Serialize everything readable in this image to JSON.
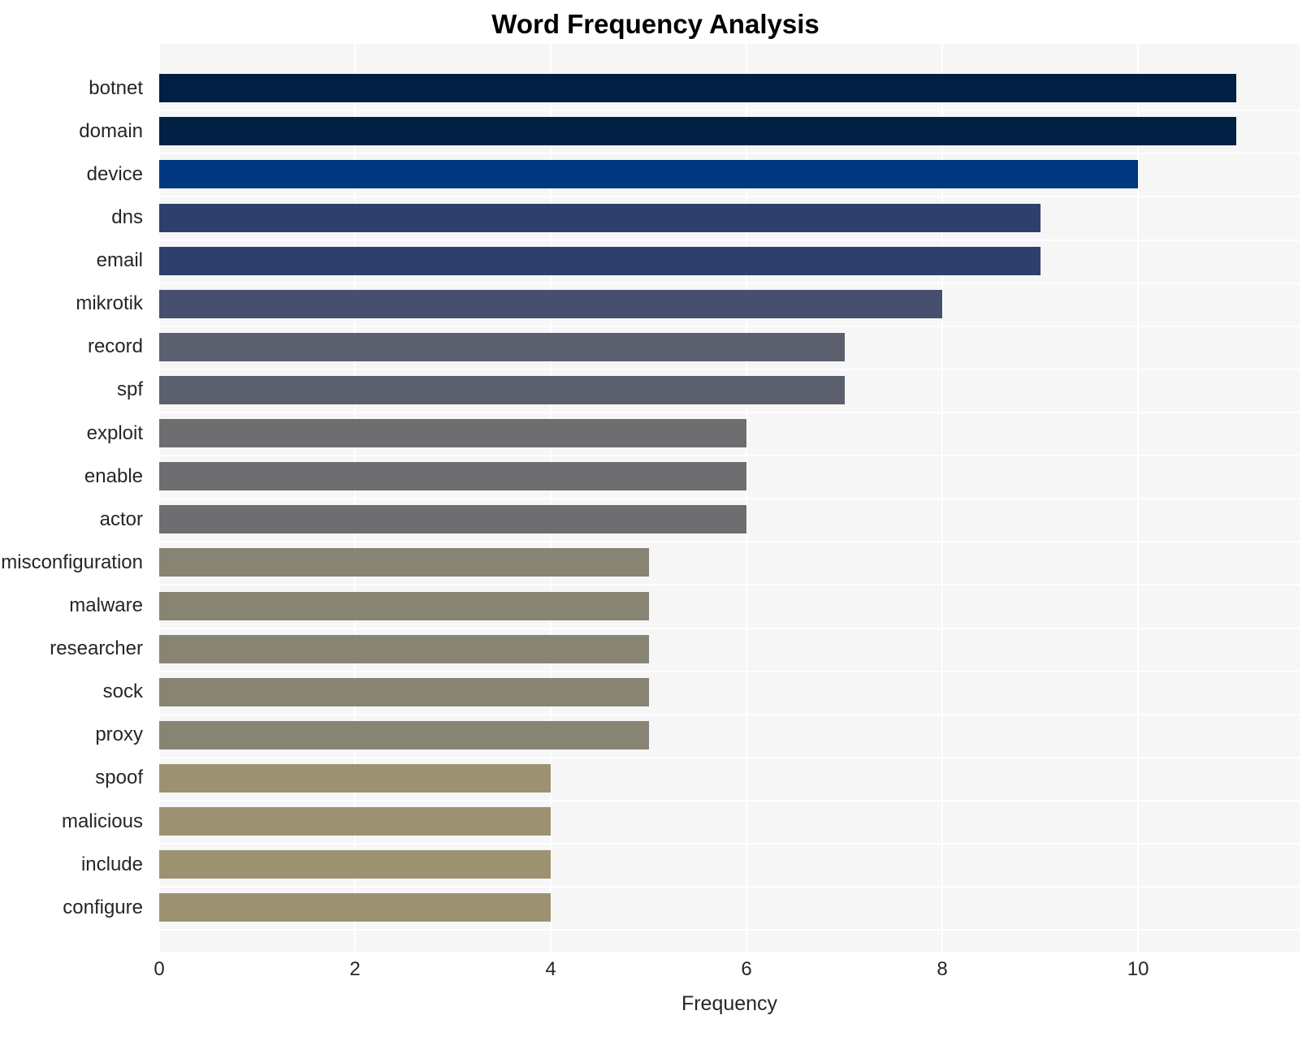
{
  "chart_data": {
    "type": "bar",
    "orientation": "horizontal",
    "title": "Word Frequency Analysis",
    "xlabel": "Frequency",
    "ylabel": "",
    "xlim": [
      0,
      11.65
    ],
    "xticks": [
      0,
      2,
      4,
      6,
      8,
      10
    ],
    "xtick_labels": [
      "0",
      "2",
      "4",
      "6",
      "8",
      "10"
    ],
    "grid": true,
    "legend": null,
    "categories": [
      "botnet",
      "domain",
      "device",
      "dns",
      "email",
      "mikrotik",
      "record",
      "spf",
      "exploit",
      "enable",
      "actor",
      "misconfiguration",
      "malware",
      "researcher",
      "sock",
      "proxy",
      "spoof",
      "malicious",
      "include",
      "configure"
    ],
    "values": [
      11,
      11,
      10,
      9,
      9,
      8,
      7,
      7,
      6,
      6,
      6,
      5,
      5,
      5,
      5,
      5,
      4,
      4,
      4,
      4
    ],
    "bar_colors": [
      "#011e43",
      "#021f44",
      "#003781",
      "#2e3f6d",
      "#2e3f6d",
      "#474f70",
      "#5b5f6e",
      "#5b5f6e",
      "#6e6e70",
      "#6e6e70",
      "#6e6e70",
      "#888474",
      "#888474",
      "#888474",
      "#888474",
      "#888474",
      "#9c9272",
      "#9c9272",
      "#9c9272",
      "#9c9272"
    ],
    "plot_background": "#f6f6f7",
    "grid_color": "#ffffff",
    "text_color": "#262626"
  }
}
